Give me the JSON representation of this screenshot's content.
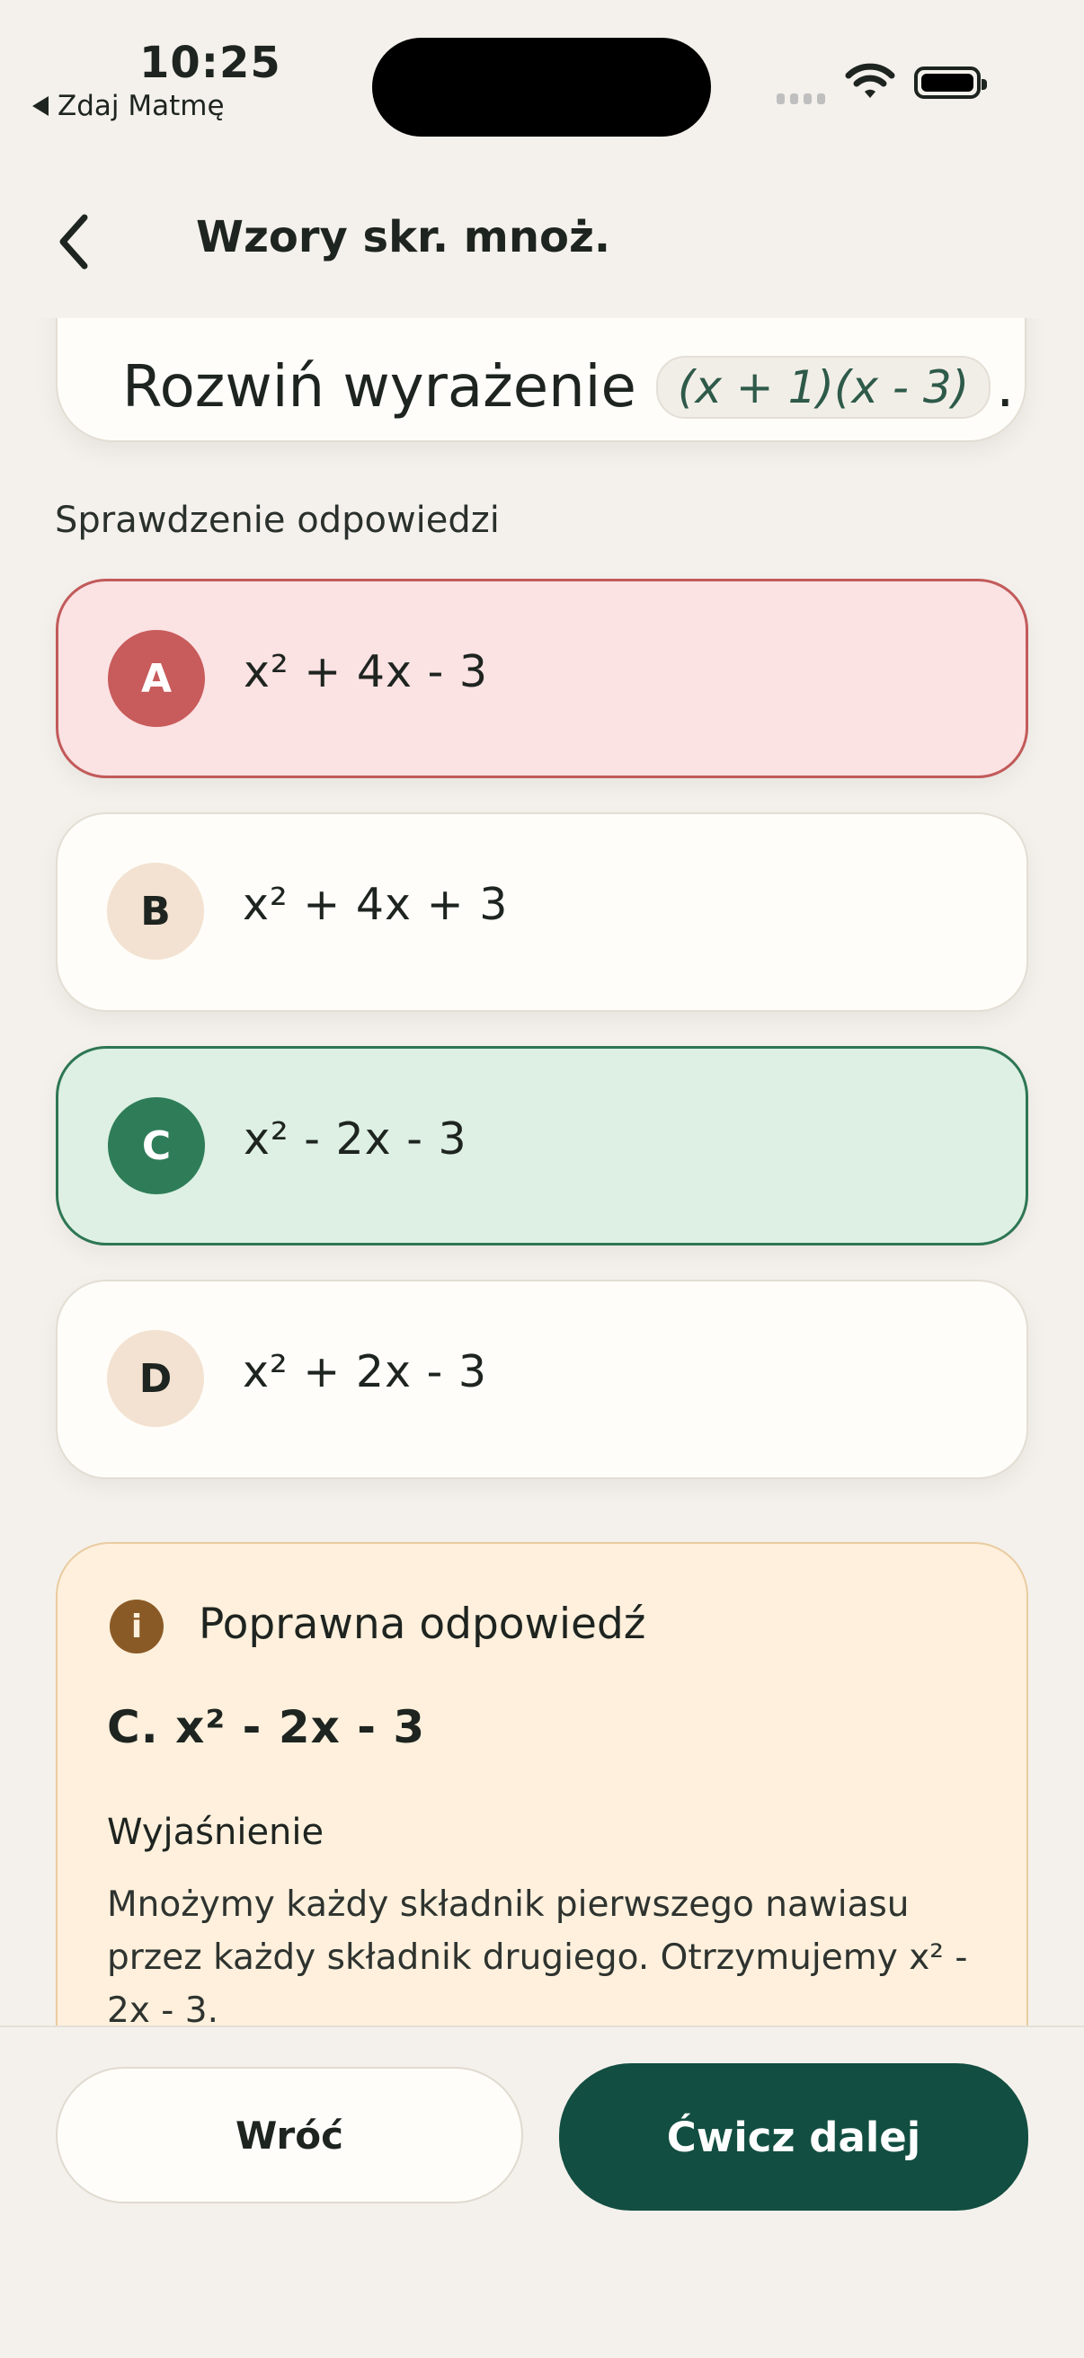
{
  "status_bar": {
    "time": "10:25",
    "back_app": "Zdaj Matmę"
  },
  "nav": {
    "title": "Wzory skr. mnoż."
  },
  "question": {
    "prefix": "Rozwiń wyrażenie",
    "expression": "(x + 1)(x - 3)",
    "suffix": "."
  },
  "section_label": "Sprawdzenie odpowiedzi",
  "options": [
    {
      "letter": "A",
      "text": "x² + 4x - 3",
      "state": "wrong"
    },
    {
      "letter": "B",
      "text": "x² + 4x + 3",
      "state": "neutral"
    },
    {
      "letter": "C",
      "text": "x² - 2x - 3",
      "state": "correct"
    },
    {
      "letter": "D",
      "text": "x² + 2x - 3",
      "state": "neutral"
    }
  ],
  "feedback": {
    "icon": "info-icon",
    "heading": "Poprawna odpowiedź",
    "answer": "C. x² - 2x - 3",
    "explanation_label": "Wyjaśnienie",
    "explanation": "Mnożymy każdy składnik pierwszego nawiasu przez każdy składnik drugiego. Otrzymujemy x² - 2x - 3."
  },
  "buttons": {
    "back": "Wróć",
    "next": "Ćwicz dalej"
  },
  "colors": {
    "background": "#F4F1EC",
    "wrong_border": "#C25A5A",
    "wrong_fill": "#FBE2E3",
    "correct_border": "#2E7653",
    "correct_fill": "#DDF0E3",
    "primary": "#124E41",
    "feedback_fill": "#FEF0DC"
  }
}
